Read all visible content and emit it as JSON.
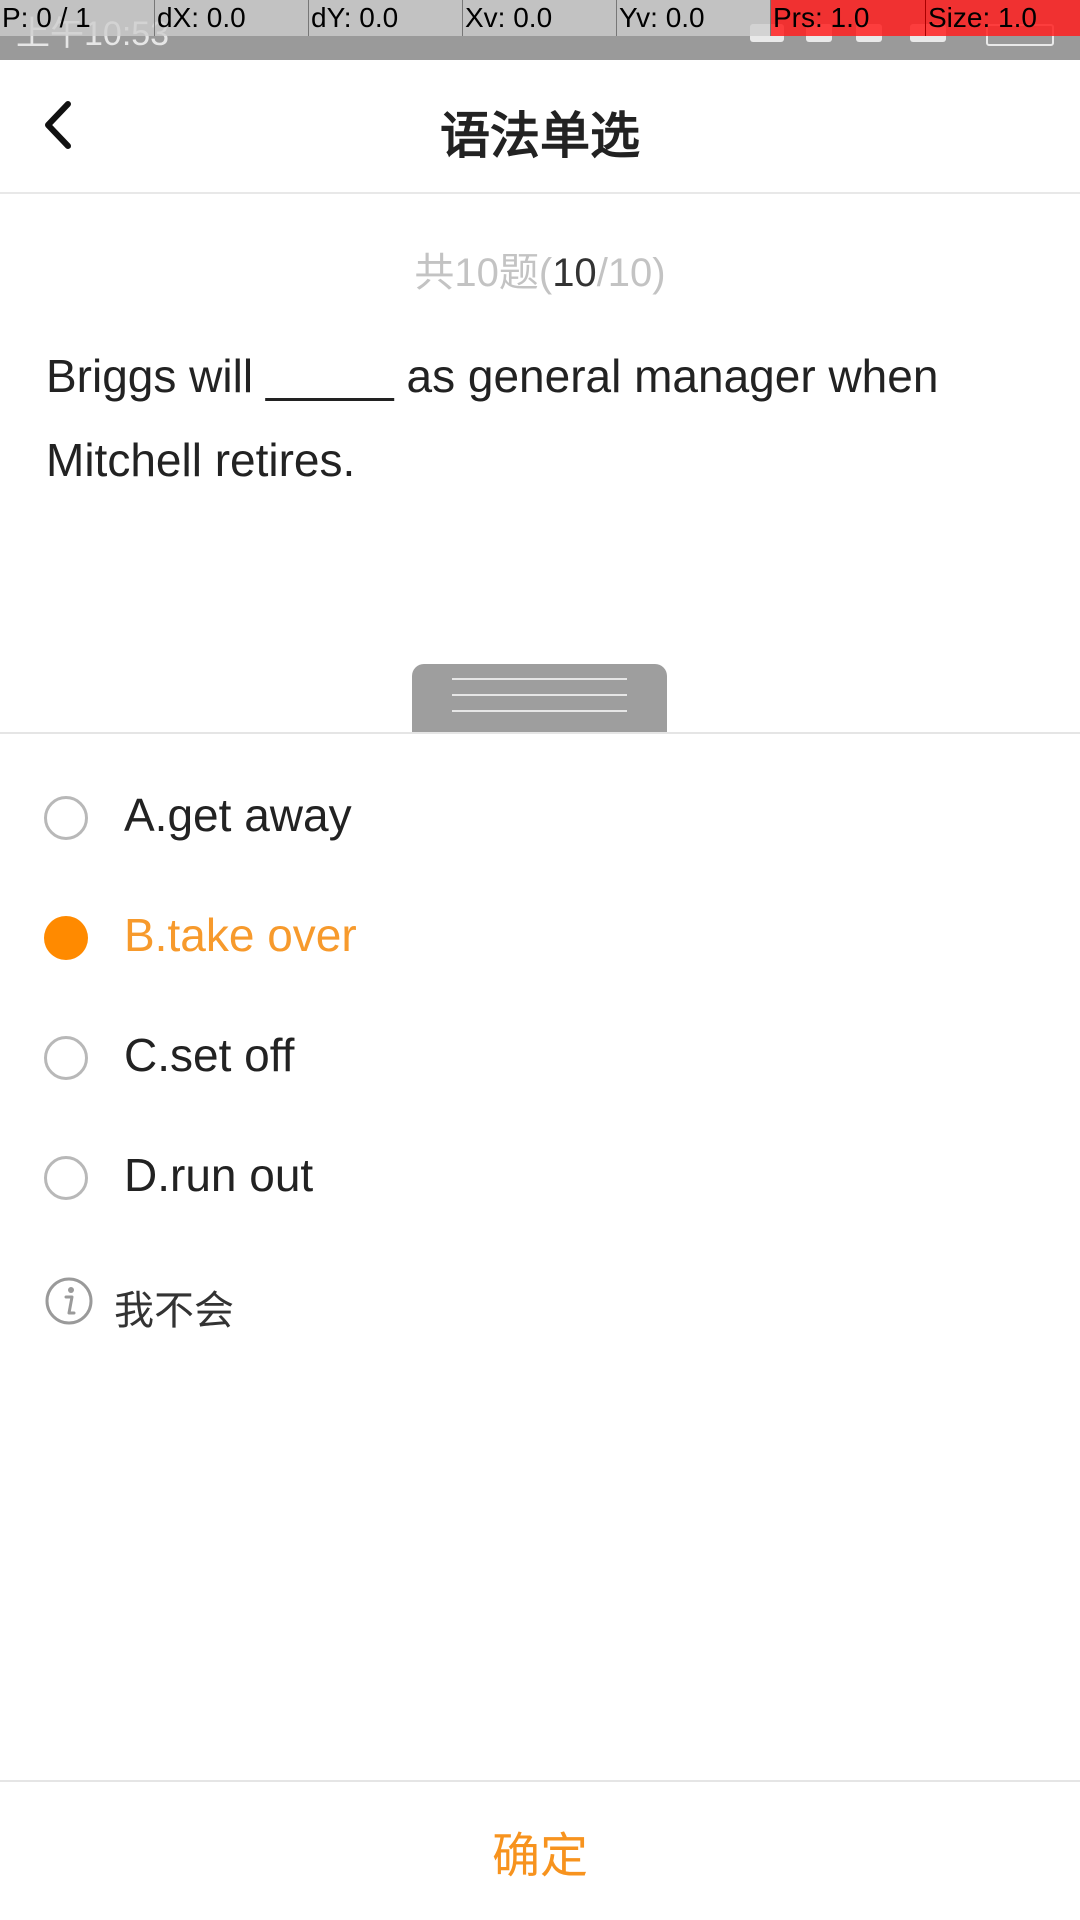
{
  "status_bar": {
    "time": "上午10:53"
  },
  "debug_overlay": [
    "P: 0 / 1",
    "dX: 0.0",
    "dY: 0.0",
    "Xv: 0.0",
    "Yv: 0.0",
    "Prs: 1.0",
    "Size: 1.0"
  ],
  "header": {
    "title": "语法单选",
    "back_icon": "chevron-left-icon"
  },
  "counter": {
    "prefix": "共10题(",
    "current": "10",
    "suffix": "/10)"
  },
  "question": {
    "text": "Briggs will _____ as general manager when Mitchell retires."
  },
  "options": [
    {
      "label": "A.get away",
      "selected": false
    },
    {
      "label": "B.take over",
      "selected": true
    },
    {
      "label": "C.set off",
      "selected": false
    },
    {
      "label": "D.run out",
      "selected": false
    }
  ],
  "dont_know": {
    "label": "我不会",
    "icon": "info-icon"
  },
  "confirm": {
    "label": "确定"
  },
  "colors": {
    "accent": "#ff8a00",
    "selected_text": "#f79a2c",
    "confirm_text": "#f7931e"
  }
}
